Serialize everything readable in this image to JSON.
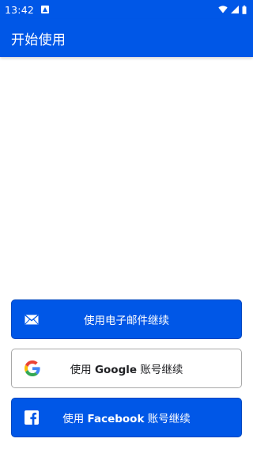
{
  "status_bar": {
    "time": "13:42",
    "icons": [
      "notification-a-icon",
      "wifi-icon",
      "signal-icon",
      "battery-icon"
    ]
  },
  "app_bar": {
    "title": "开始使用"
  },
  "buttons": {
    "email": {
      "label": "使用电子邮件继续",
      "icon": "mail-icon"
    },
    "google": {
      "prefix": "使用 ",
      "brand": "Google",
      "suffix": " 账号继续",
      "icon": "google-icon"
    },
    "facebook": {
      "prefix": "使用 ",
      "brand": "Facebook",
      "suffix": " 账号继续",
      "icon": "facebook-icon"
    }
  },
  "colors": {
    "primary": "#0057e7",
    "white": "#ffffff",
    "google_blue": "#4285F4",
    "google_red": "#EA4335",
    "google_yellow": "#FBBC05",
    "google_green": "#34A853"
  }
}
